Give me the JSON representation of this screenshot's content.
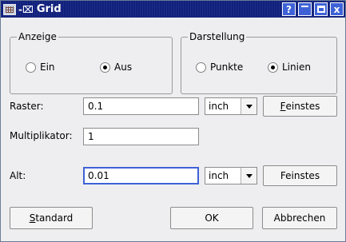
{
  "window": {
    "title": "Grid",
    "titlebar_buttons": [
      "?",
      "minimize",
      "maximize",
      "close"
    ],
    "close_glyph": "x",
    "help_glyph": "?"
  },
  "anzeige": {
    "legend": "Anzeige",
    "options": [
      {
        "label": "Ein",
        "checked": false
      },
      {
        "label": "Aus",
        "checked": true
      }
    ]
  },
  "darstellung": {
    "legend": "Darstellung",
    "options": [
      {
        "label": "Punkte",
        "checked": false
      },
      {
        "label": "Linien",
        "checked": true
      }
    ]
  },
  "raster": {
    "label": "Raster:",
    "value": "0.1",
    "unit": "inch",
    "button_mnemonic": "F",
    "button_rest": "einstes"
  },
  "multiplikator": {
    "label": "Multiplikator:",
    "value": "1"
  },
  "alt": {
    "label": "Alt:",
    "value": "0.01",
    "unit": "inch",
    "button": "Feinstes"
  },
  "footer": {
    "standard_mnemonic": "S",
    "standard_rest": "tandard",
    "ok": "OK",
    "abbrechen": "Abbrechen"
  }
}
